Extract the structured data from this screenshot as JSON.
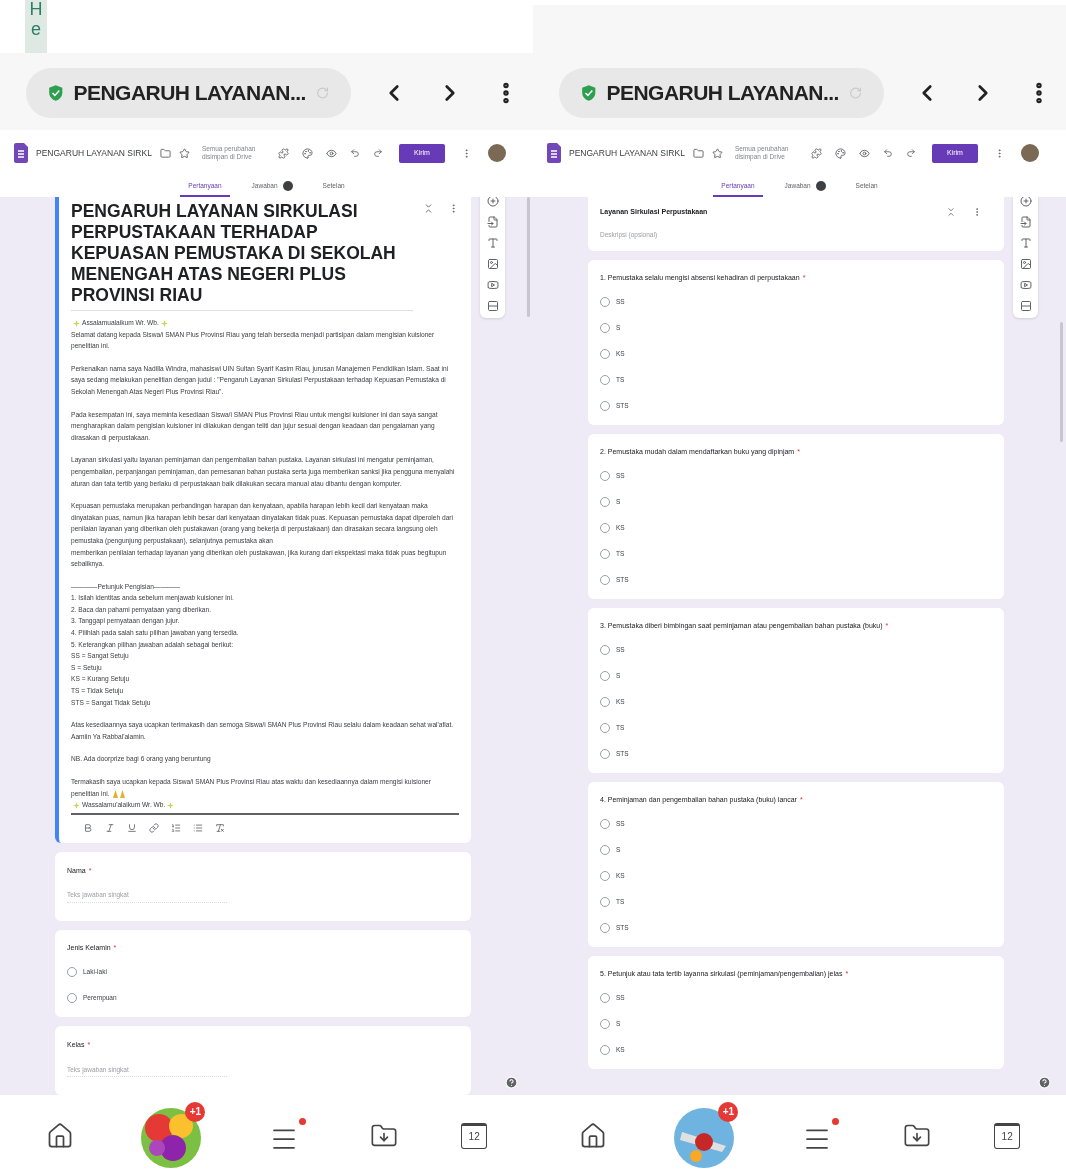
{
  "screens": [
    {
      "corner_text": "He",
      "browser": {
        "title": "PENGARUH LAYANAN..."
      },
      "app": {
        "doc_title": "PENGARUH LAYANAN SIRKL",
        "save_status": "Semua perubahan disimpan di Drive",
        "send_label": "Kirim"
      },
      "tabs": [
        {
          "label": "Pertanyaan",
          "selected": true,
          "badge": false
        },
        {
          "label": "Jawaban",
          "selected": false,
          "badge": true
        },
        {
          "label": "Setelan",
          "selected": false,
          "badge": false
        }
      ],
      "cards": [
        {
          "kind": "header",
          "active": true,
          "title": "PENGARUH LAYANAN SIRKULASI PERPUSTAKAAN TERHADAP KEPUASAN PEMUSTAKA DI SEKOLAH MENENGAH ATAS NEGERI PLUS PROVINSI RIAU",
          "blocks": [
            [
              {
                "text": "Assalamualaikum Wr. Wb.",
                "kind": "sparkles"
              },
              "Selamat datang kepada Siswa/i SMAN Plus Provinsi Riau yang telah bersedia menjadi partisipan dalam mengisian kuisioner penelitian ini."
            ],
            [
              "Perkenalkan nama saya Nadilla Windra, mahasiswi UIN Sultan Syarif Kasim Riau, jurusan Manajemen Pendidikan Islam. Saat ini saya sedang melakukan penelitian dengan judul : \"Pengaruh Layanan Sirkulasi Perpustakaan terhadap Kepuasan Pemustaka di Sekolah Menengah Atas Negeri Plus Provinsi Riau\"."
            ],
            [
              "Pada kesempatan ini, saya meminta kesediaan Siswa/i SMAN Plus Provinsi Riau untuk mengisi kuisioner ini dan saya sangat mengharapkan dalam pengisian kuisioner ini dilakukan dengan teliti dan jujur sesuai dengan keadaan dan pengalaman yang dirasakan di perpustakaan."
            ],
            [
              "Layanan sirkulasi yaitu layanan peminjaman dan pengembalian bahan pustaka. Layanan sirkulasi ini mengatur peminjaman, pengembalian, perpanjangan peminjaman, dan pemesanan bahan pustaka serta juga memberikan sanksi jika pengguna menyalahi aturan dan tata tertib yang berlaku di perpustakaan baik dilakukan secara manual atau dibantu dengan komputer."
            ],
            [
              "Kepuasan pemustaka merupakan perbandingan harapan dan kenyataan, apabila harapan lebih kecil dari kenyataan maka dinyatakan puas, namun jika harapan lebih besar dari kenyataan dinyatakan tidak puas. Kepuasan pemustaka dapat diperoleh dari penilaian layanan yang diberikan oleh pustakawan (orang yang bekerja di perpustakaan) dan dirasakan secara langsung oleh pemustaka (pengunjung perpustakaan), selanjutnya pemustaka akan",
              "memberikan penilaian terhadap layanan yang diberikan oleh pustakawan, jika kurang dari ekspektasi maka tidak puas begitupun sebaliknya."
            ],
            [
              "————Petunjuk Pengisian————",
              "1. Isilah identitas anda sebelum menjawab kuisioner ini.",
              "2. Baca dan pahami pernyataan yang diberikan.",
              "3. Tanggapi pernyataan dengan jujur.",
              "4. Pilihlah pada salah satu pilihan jawaban yang tersedia.",
              "5. Keterangkan pilihan jawaban adalah sebagai berikut:",
              "SS = Sangat Setuju",
              "S = Setuju",
              "KS = Kurang Setuju",
              "TS = Tidak Setuju",
              "STS = Sangat Tidak Setuju"
            ],
            [
              "Atas kesediaannya saya ucapkan terimakasih dan semoga Siswa/i SMAN Plus Provinsi Riau selalu dalam keadaan sehat wal'afiat. Aamiin Ya Rabbal'alamin."
            ],
            [
              "NB. Ada doorprize bagi 6 orang yang beruntung"
            ],
            [
              {
                "text": "Termakasih saya ucapkan kepada Siswa/i SMAN Plus Provinsi Riau atas waktu dan kesediaannya dalam mengisi kuisioner penelitian ini.",
                "kind": "hands"
              },
              {
                "text": "Wassalamu'alaikum Wr. Wb.",
                "kind": "sparkles"
              }
            ]
          ]
        },
        {
          "kind": "short",
          "title": "Nama",
          "required_mark": "*",
          "placeholder": "Teks jawaban singkat"
        },
        {
          "kind": "choice",
          "title": "Jenis Kelamin",
          "required_mark": "*",
          "options": [
            {
              "label": "Laki-laki",
              "selected": false
            },
            {
              "label": "Perempuan",
              "selected": false
            }
          ]
        },
        {
          "kind": "short",
          "title": "Kelas",
          "required_mark": "*",
          "placeholder": "Teks jawaban singkat"
        }
      ],
      "nav": [
        {
          "kind": "home"
        },
        {
          "kind": "fruit_game",
          "badge": "+1"
        },
        {
          "kind": "menu",
          "dot": true
        },
        {
          "kind": "download"
        },
        {
          "kind": "calendar",
          "label": "12"
        }
      ]
    },
    {
      "browser": {
        "title": "PENGARUH LAYANAN..."
      },
      "app": {
        "doc_title": "PENGARUH LAYANAN SIRKL",
        "save_status": "Semua perubahan disimpan di Drive",
        "send_label": "Kirim"
      },
      "tabs": [
        {
          "label": "Pertanyaan",
          "selected": true,
          "badge": false
        },
        {
          "label": "Jawaban",
          "selected": false,
          "badge": true
        },
        {
          "label": "Setelan",
          "selected": false,
          "badge": false
        }
      ],
      "cards": [
        {
          "kind": "section",
          "title": "Layanan Sirkulasi Perpustakaan",
          "placeholder": "Deskripsi (opsional)"
        },
        {
          "kind": "choice",
          "title": "1. Pemustaka selalu mengisi absensi kehadiran di perpustakaan",
          "required_mark": "*",
          "options": [
            {
              "label": "SS",
              "selected": false
            },
            {
              "label": "S",
              "selected": false
            },
            {
              "label": "KS",
              "selected": false
            },
            {
              "label": "TS",
              "selected": false
            },
            {
              "label": "STS",
              "selected": false
            }
          ]
        },
        {
          "kind": "choice",
          "title": "2. Pemustaka mudah dalam mendaftarkan buku yang dipinjam",
          "required_mark": "*",
          "options": [
            {
              "label": "SS",
              "selected": false
            },
            {
              "label": "S",
              "selected": false
            },
            {
              "label": "KS",
              "selected": false
            },
            {
              "label": "TS",
              "selected": false
            },
            {
              "label": "STS",
              "selected": false
            }
          ]
        },
        {
          "kind": "choice",
          "title": "3. Pemustaka diberi bimbingan saat peminjaman atau pengembalian bahan pustaka (buku)",
          "required_mark": "*",
          "options": [
            {
              "label": "SS",
              "selected": false
            },
            {
              "label": "S",
              "selected": false
            },
            {
              "label": "KS",
              "selected": false
            },
            {
              "label": "TS",
              "selected": false
            },
            {
              "label": "STS",
              "selected": false
            }
          ]
        },
        {
          "kind": "choice",
          "title": "4. Peminjaman dan pengembalian bahan pustaka (buku) lancar",
          "required_mark": "*",
          "options": [
            {
              "label": "SS",
              "selected": false
            },
            {
              "label": "S",
              "selected": false
            },
            {
              "label": "KS",
              "selected": false
            },
            {
              "label": "TS",
              "selected": false
            },
            {
              "label": "STS",
              "selected": false
            }
          ]
        },
        {
          "kind": "choice",
          "title": "5. Petunjuk atau tata tertib layanna sirkulasi (peminjaman/pengembalian) jelas",
          "required_mark": "*",
          "options": [
            {
              "label": "SS",
              "selected": false
            },
            {
              "label": "S",
              "selected": false
            },
            {
              "label": "KS",
              "selected": false
            }
          ]
        }
      ],
      "nav": [
        {
          "kind": "home"
        },
        {
          "kind": "ball_game",
          "badge": "+1"
        },
        {
          "kind": "menu",
          "dot": true
        },
        {
          "kind": "download"
        },
        {
          "kind": "calendar",
          "label": "12"
        }
      ]
    }
  ]
}
